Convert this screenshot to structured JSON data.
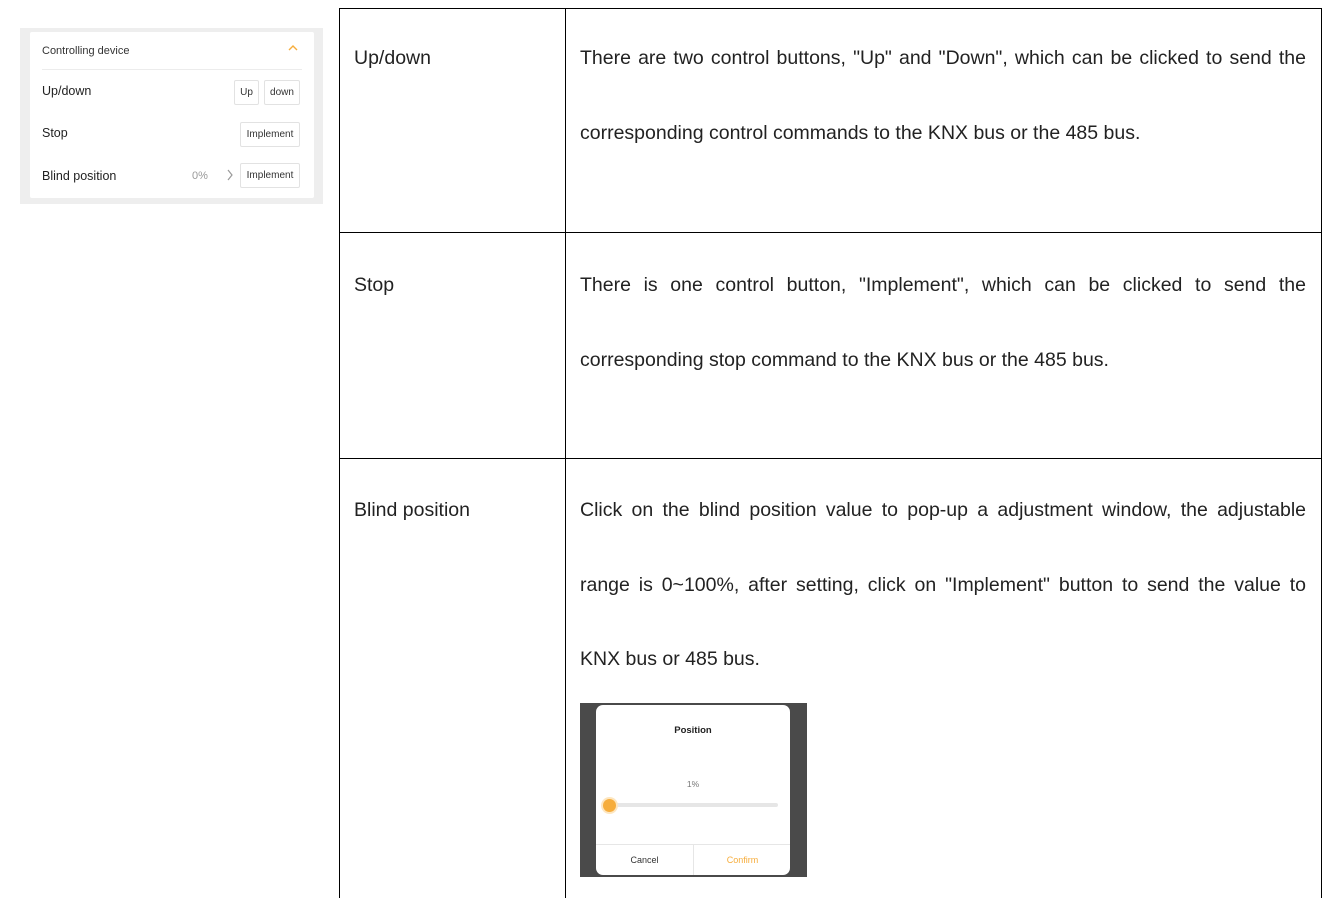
{
  "panel": {
    "header": "Controlling device",
    "rows": [
      {
        "label": "Up/down",
        "buttons": [
          "Up",
          "down"
        ]
      },
      {
        "label": "Stop",
        "buttons": [
          "Implement"
        ]
      },
      {
        "label": "Blind position",
        "value": "0%",
        "buttons": [
          "Implement"
        ]
      }
    ],
    "colors": {
      "accent": "#f6ad3c"
    },
    "icons": {
      "collapse": "chevron-up-icon",
      "next": "chevron-right-icon"
    }
  },
  "table": {
    "rows": [
      {
        "name": "Up/down",
        "description": "There are two control buttons, \"Up\" and \"Down\", which can be clicked to send the corresponding control commands to the KNX bus or the 485 bus."
      },
      {
        "name": "Stop",
        "description": "There is one control button, \"Implement\", which can be clicked to send the corresponding stop command to the KNX bus or the 485 bus."
      },
      {
        "name": "Blind position",
        "description": "Click on the blind position value to pop-up a adjustment window, the adjustable range is 0~100%, after setting, click on \"Implement\" button to send the value to KNX bus or 485 bus."
      }
    ]
  },
  "popup": {
    "title": "Position",
    "value": "1%",
    "slider_level": 1,
    "cancel": "Cancel",
    "confirm": "Confirm"
  }
}
